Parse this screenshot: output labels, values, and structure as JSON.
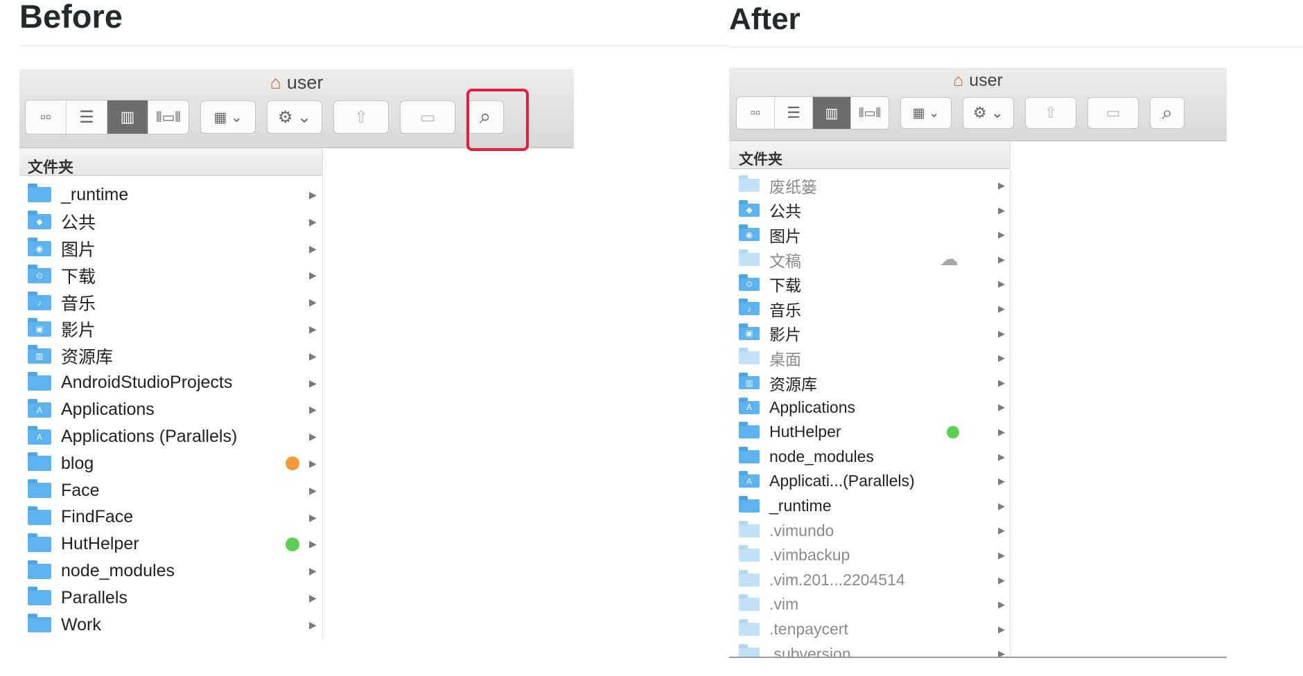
{
  "before": {
    "heading": "Before",
    "window": {
      "title": "user",
      "view_buttons": [
        "grid-icon",
        "list-icon",
        "columns-icon",
        "coverflow-icon"
      ],
      "active_view": "columns-icon",
      "group_icon": "group-icon",
      "action_icon": "gear-icon",
      "share_icon": "share-icon",
      "tag_icon": "tag-icon",
      "search_icon": "search-icon",
      "search_highlight_color": "#e02040",
      "column_header": "文件夹",
      "items": [
        {
          "label": "_runtime",
          "icon": "folder-icon"
        },
        {
          "label": "公共",
          "icon": "public-folder-icon"
        },
        {
          "label": "图片",
          "icon": "pictures-folder-icon"
        },
        {
          "label": "下载",
          "icon": "downloads-folder-icon"
        },
        {
          "label": "音乐",
          "icon": "music-folder-icon"
        },
        {
          "label": "影片",
          "icon": "movies-folder-icon"
        },
        {
          "label": "资源库",
          "icon": "library-folder-icon"
        },
        {
          "label": "AndroidStudioProjects",
          "icon": "folder-icon"
        },
        {
          "label": "Applications",
          "icon": "applications-folder-icon"
        },
        {
          "label": "Applications (Parallels)",
          "icon": "applications-folder-icon"
        },
        {
          "label": "blog",
          "icon": "folder-icon",
          "tag": "#f39a3c"
        },
        {
          "label": "Face",
          "icon": "folder-icon"
        },
        {
          "label": "FindFace",
          "icon": "folder-icon"
        },
        {
          "label": "HutHelper",
          "icon": "folder-icon",
          "tag": "#5ccf52"
        },
        {
          "label": "node_modules",
          "icon": "folder-icon"
        },
        {
          "label": "Parallels",
          "icon": "folder-icon"
        },
        {
          "label": "Work",
          "icon": "folder-icon"
        }
      ]
    }
  },
  "after": {
    "heading": "After",
    "window": {
      "title": "user",
      "column_header": "文件夹",
      "items": [
        {
          "label": "废纸篓",
          "icon": "trash-folder-icon",
          "dim": true
        },
        {
          "label": "公共",
          "icon": "public-folder-icon"
        },
        {
          "label": "图片",
          "icon": "pictures-folder-icon"
        },
        {
          "label": "文稿",
          "icon": "documents-folder-icon",
          "dim": true,
          "cloud": true
        },
        {
          "label": "下载",
          "icon": "downloads-folder-icon"
        },
        {
          "label": "音乐",
          "icon": "music-folder-icon"
        },
        {
          "label": "影片",
          "icon": "movies-folder-icon"
        },
        {
          "label": "桌面",
          "icon": "desktop-folder-icon",
          "dim": true
        },
        {
          "label": "资源库",
          "icon": "library-folder-icon"
        },
        {
          "label": "Applications",
          "icon": "applications-folder-icon"
        },
        {
          "label": "HutHelper",
          "icon": "folder-icon",
          "tag": "#5ccf52"
        },
        {
          "label": "node_modules",
          "icon": "folder-icon"
        },
        {
          "label": "Applicati...(Parallels)",
          "icon": "applications-folder-icon"
        },
        {
          "label": "_runtime",
          "icon": "folder-icon"
        },
        {
          "label": ".vimundo",
          "icon": "folder-icon",
          "dim": true
        },
        {
          "label": ".vimbackup",
          "icon": "folder-icon",
          "dim": true
        },
        {
          "label": ".vim.201...2204514",
          "icon": "folder-icon",
          "dim": true
        },
        {
          "label": ".vim",
          "icon": "folder-icon",
          "dim": true
        },
        {
          "label": ".tenpaycert",
          "icon": "folder-icon",
          "dim": true
        },
        {
          "label": ".subversion",
          "icon": "folder-icon",
          "dim": true
        }
      ]
    }
  }
}
